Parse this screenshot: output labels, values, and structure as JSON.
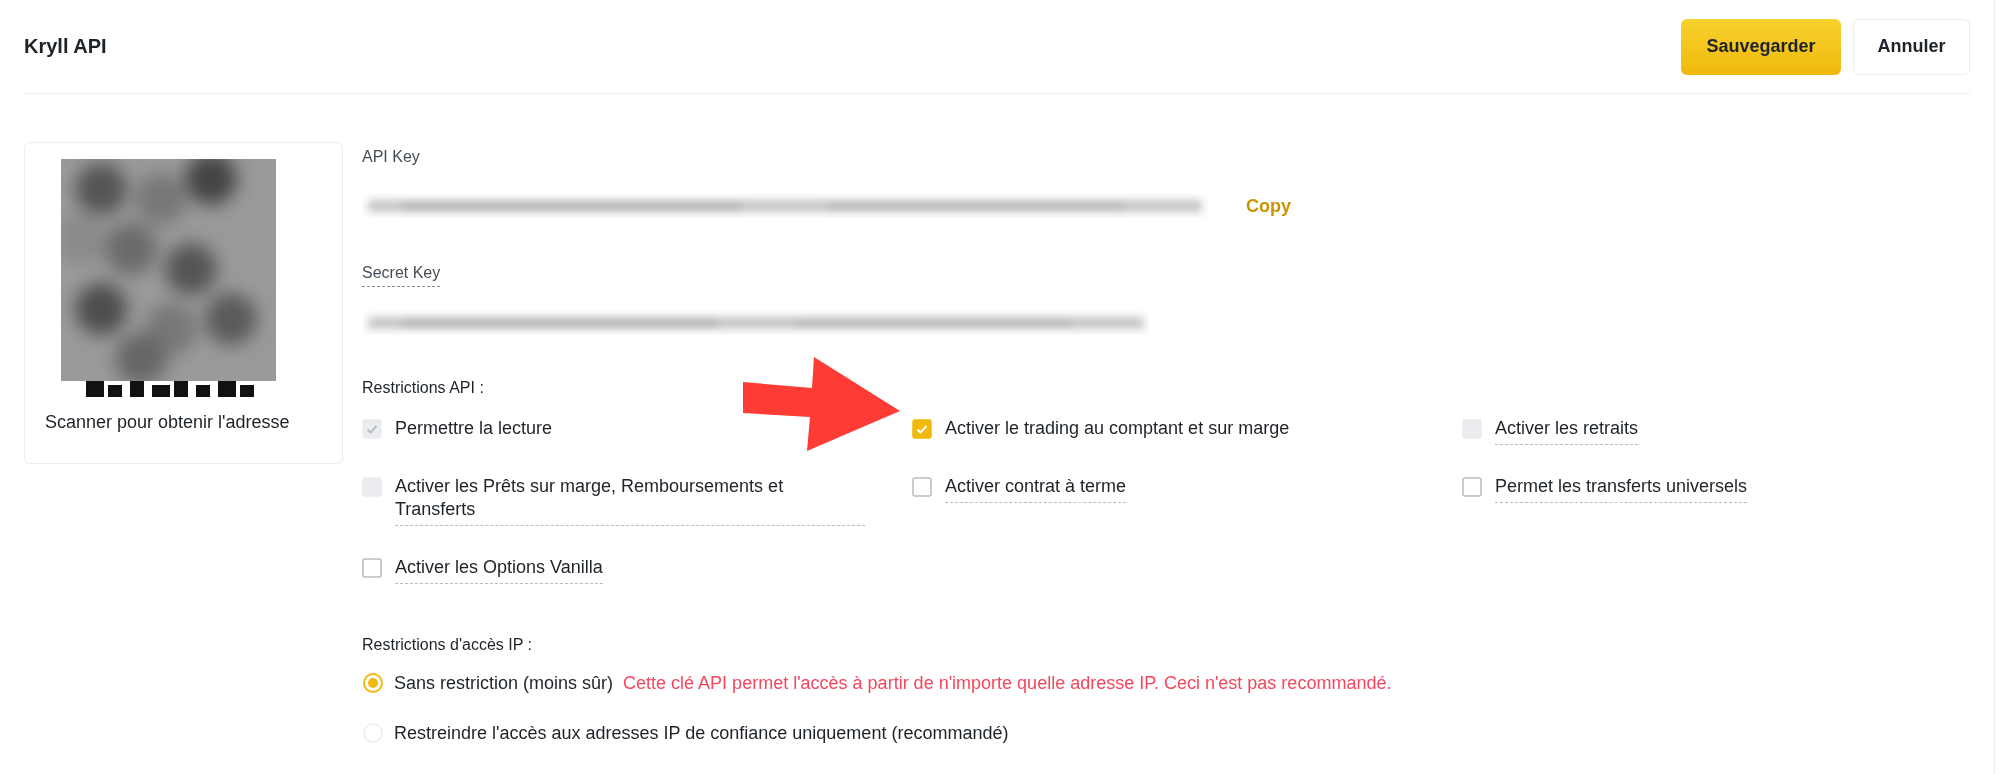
{
  "header": {
    "title": "Kryll API",
    "buttons": [
      {
        "label": "Sauvegarder",
        "kind": "primary"
      },
      {
        "label": "Annuler",
        "kind": "secondary"
      }
    ]
  },
  "qr_card": {
    "caption": "Scanner pour obtenir l'adresse"
  },
  "keys": [
    {
      "label": "API Key",
      "hint": false,
      "action": "Copy"
    },
    {
      "label": "Secret Key",
      "hint": true
    }
  ],
  "api_restrictions": {
    "label": "Restrictions API :",
    "options": [
      {
        "label": "Permettre la lecture",
        "checked": true,
        "disabled": true,
        "hint": false
      },
      {
        "label": "Activer le trading au comptant et sur marge",
        "checked": true,
        "disabled": false,
        "hint": false
      },
      {
        "label": "Activer les retraits",
        "checked": false,
        "disabled": true,
        "hint": true
      },
      {
        "label": "Activer les Prêts sur marge, Remboursements et Transferts",
        "checked": false,
        "disabled": true,
        "hint": true
      },
      {
        "label": "Activer contrat à terme",
        "checked": false,
        "disabled": false,
        "hint": true
      },
      {
        "label": "Permet les transferts universels",
        "checked": false,
        "disabled": false,
        "hint": true
      },
      {
        "label": "Activer les Options Vanilla",
        "checked": false,
        "disabled": false,
        "hint": true
      }
    ]
  },
  "ip_restrictions": {
    "label": "Restrictions d'accès IP :",
    "options": [
      {
        "label": "Sans restriction (moins sûr)",
        "selected": true,
        "warning": "Cette clé API permet l'accès à partir de n'importe quelle adresse IP. Ceci n'est pas recommandé."
      },
      {
        "label": "Restreindre l'accès aux adresses IP de confiance uniquement (recommandé)",
        "selected": false
      }
    ]
  },
  "annotations": [
    {
      "kind": "arrow"
    }
  ]
}
